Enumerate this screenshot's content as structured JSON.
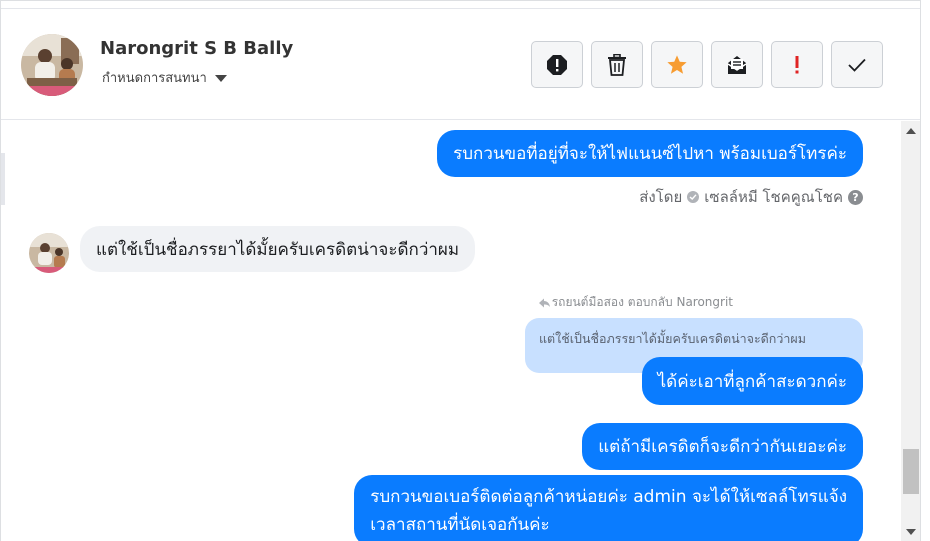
{
  "header": {
    "contact_name": "Narongrit S B Bally",
    "assign_label": "กำหนดการสนทนา"
  },
  "actions": [
    {
      "name": "spam-button",
      "icon": "alert-octagon-icon"
    },
    {
      "name": "delete-button",
      "icon": "trash-icon"
    },
    {
      "name": "star-button",
      "icon": "star-icon",
      "color": "#f79c31"
    },
    {
      "name": "mark-unread-button",
      "icon": "open-mail-icon"
    },
    {
      "name": "important-button",
      "icon": "exclamation-icon",
      "color": "#e02424"
    },
    {
      "name": "done-button",
      "icon": "check-icon"
    }
  ],
  "messages": {
    "m1": "รบกวนขอที่อยู่ที่จะให้ไฟแนนซ์ไปหา พร้อมเบอร์โทรค่ะ",
    "sent_by_label": "ส่งโดย",
    "sent_by_name": "เซลล์หมี โชคคูณโชค",
    "m2": "แต่ใช้เป็นชื่อภรรยาได้มั้ยครับเครดิตน่าจะดีกว่าผม",
    "reply_header": "รถยนต์มือสอง ตอบกลับ Narongrit",
    "quoted": "แต่ใช้เป็นชื่อภรรยาได้มั้ยครับเครดิตน่าจะดีกว่าผม",
    "m3": "ได้ค่ะเอาที่ลูกค้าสะดวกค่ะ",
    "m4": "แต่ถ้ามีเครดิตก็จะดีกว่ากันเยอะค่ะ",
    "m5_line1": "รบกวนขอเบอร์ติดต่อลูกค้าหน่อยค่ะ admin จะได้ให้เซลล์โทรแจ้ง",
    "m5_line2": "เวลาสถานที่นัดเจอกันค่ะ"
  },
  "colors": {
    "outgoing_bubble": "#0a7cff",
    "incoming_bubble": "#f0f2f5",
    "quoted_bubble": "#c8e0ff"
  }
}
